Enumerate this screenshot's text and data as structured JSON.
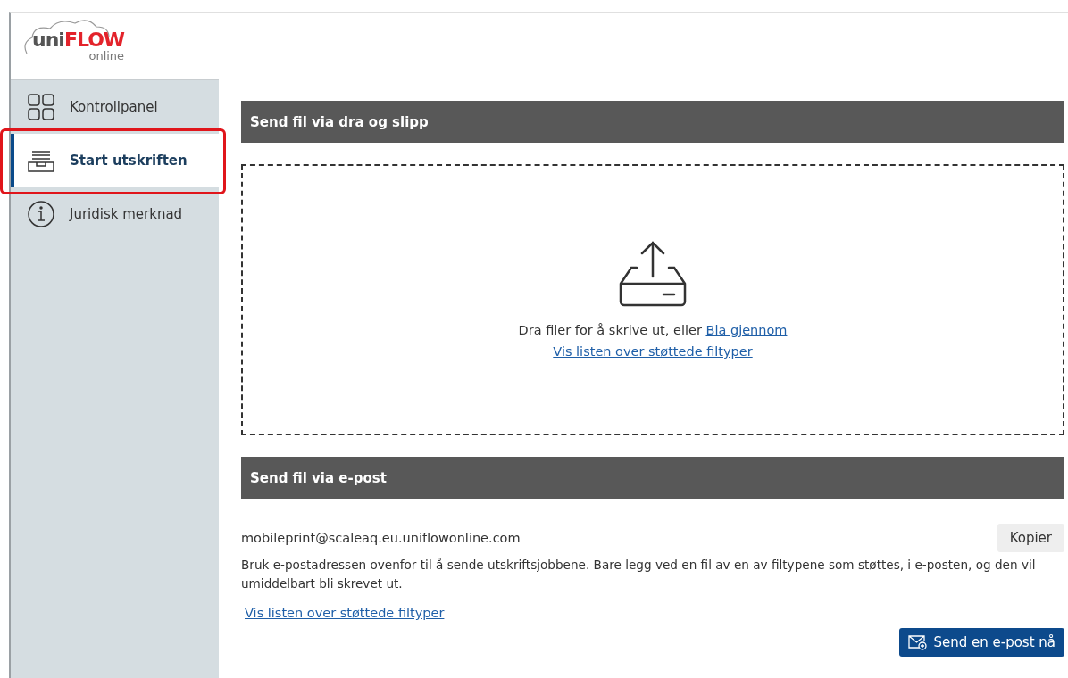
{
  "logo": {
    "prefix": "uni",
    "brand": "FLOW",
    "suffix": "online"
  },
  "sidebar": {
    "items": [
      {
        "label": "Kontrollpanel",
        "kind": "grid",
        "selected": false,
        "annotated": false
      },
      {
        "label": "Start utskriften",
        "kind": "tray",
        "selected": true,
        "annotated": true
      },
      {
        "label": "Juridisk merknad",
        "kind": "info",
        "selected": false,
        "annotated": false
      }
    ]
  },
  "drop_section": {
    "title": "Send fil via dra og slipp",
    "prompt": "Dra filer for å skrive ut, eller",
    "browse_link": "Bla gjennom",
    "types_link": "Vis listen over støttede filtyper"
  },
  "email_section": {
    "title": "Send fil via e-post",
    "address": "mobileprint@scaleaq.eu.uniflowonline.com",
    "copy_button": "Kopier",
    "description": "Bruk e-postadressen ovenfor til å sende utskriftsjobbene. Bare legg ved en fil av en av filtypene som støttes, i e-posten, og den vil umiddelbart bli skrevet ut.",
    "types_link": "Vis listen over støttede filtyper",
    "send_button": "Send en e-post nå"
  }
}
